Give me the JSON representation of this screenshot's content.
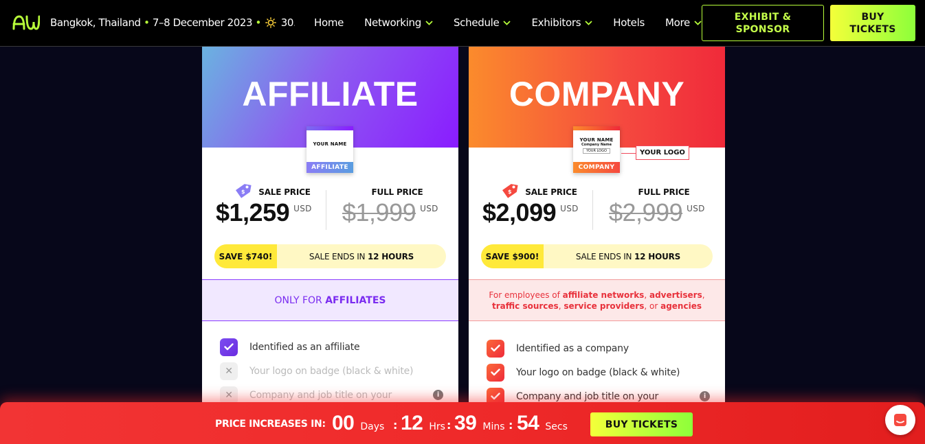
{
  "nav": {
    "logo_text": "AW",
    "location": "Bangkok, Thailand",
    "dates": "7–8 December 2023",
    "temperature": "30.8°C",
    "menu": [
      {
        "label": "Home",
        "has_dropdown": false
      },
      {
        "label": "Networking",
        "has_dropdown": true
      },
      {
        "label": "Schedule",
        "has_dropdown": true
      },
      {
        "label": "Exhibitors",
        "has_dropdown": true
      },
      {
        "label": "Hotels",
        "has_dropdown": false
      },
      {
        "label": "More",
        "has_dropdown": true
      }
    ],
    "exhibit_button": "EXHIBIT & SPONSOR",
    "buy_button": "BUY TICKETS"
  },
  "cards": {
    "affiliate": {
      "title": "AFFILIATE",
      "badge_name": "YOUR NAME",
      "badge_footer": "AFFILIATE",
      "sale_label": "SALE PRICE",
      "sale_price": "$1,259",
      "sale_currency": "USD",
      "full_label": "FULL PRICE",
      "full_price": "$1,999",
      "full_currency": "USD",
      "save": "SAVE $740!",
      "ends_prefix": "SALE ENDS IN",
      "ends_value": "12 HOURS",
      "audience_prefix": "ONLY FOR",
      "audience_highlight": "AFFILIATES",
      "features": [
        {
          "label": "Identified as an affiliate",
          "included": true
        },
        {
          "label": "Your logo on badge (black & white)",
          "included": false
        },
        {
          "label": "Company and job title on your",
          "included": false
        }
      ]
    },
    "company": {
      "title": "COMPANY",
      "badge_name": "YOUR NAME",
      "badge_company": "Company Name",
      "badge_logo": "YOUR LOGO",
      "badge_footer": "COMPANY",
      "callout_logo": "YOUR LOGO",
      "sale_label": "SALE PRICE",
      "sale_price": "$2,099",
      "sale_currency": "USD",
      "full_label": "FULL PRICE",
      "full_price": "$2,999",
      "full_currency": "USD",
      "save": "SAVE $900!",
      "ends_prefix": "SALE ENDS IN",
      "ends_value": "12 HOURS",
      "audience": {
        "p1": "For employees of ",
        "b1": "affiliate networks",
        "p2": ", ",
        "b2": "advertisers",
        "p3": ", ",
        "b3": "traffic sources",
        "p4": ", ",
        "b4": "service providers",
        "p5": ", or ",
        "b5": "agencies"
      },
      "features": [
        {
          "label": "Identified as a company",
          "included": true
        },
        {
          "label": "Your logo on badge (black & white)",
          "included": true
        },
        {
          "label": "Company and job title on your",
          "included": true
        }
      ]
    }
  },
  "countdown": {
    "label": "PRICE INCREASES IN:",
    "days": "00",
    "days_unit": "Days",
    "hours": "12",
    "hours_unit": "Hrs",
    "mins": "39",
    "mins_unit": "Mins",
    "secs": "54",
    "secs_unit": "Secs",
    "button": "BUY TICKETS"
  },
  "colors": {
    "accent_green": "#b8ff3a",
    "affiliate_purple": "#8a1cff",
    "company_red": "#f02a3a",
    "countdown_red": "#ef2a2a"
  },
  "icons": [
    "aw-logo-icon",
    "sun-icon",
    "chevron-down-icon",
    "price-tag-icon",
    "check-icon",
    "x-icon",
    "info-icon",
    "chat-icon"
  ]
}
